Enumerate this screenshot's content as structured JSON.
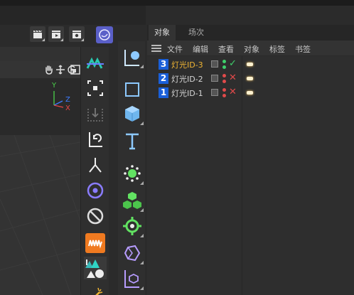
{
  "object_manager": {
    "tabs": [
      {
        "label": "对象",
        "active": true
      },
      {
        "label": "场次",
        "active": false
      }
    ],
    "menu": [
      "文件",
      "编辑",
      "查看",
      "对象",
      "标签",
      "书签"
    ],
    "objects": [
      {
        "index": "3",
        "name": "灯光ID-3",
        "selected": true,
        "status": "check",
        "status_icon": "✓"
      },
      {
        "index": "2",
        "name": "灯光ID-2",
        "selected": false,
        "status": "cross",
        "status_icon": "✕"
      },
      {
        "index": "1",
        "name": "灯光ID-1",
        "selected": false,
        "status": "cross",
        "status_icon": "✕"
      }
    ]
  },
  "viewport": {
    "axes": {
      "y": "Y",
      "z": "Z",
      "x": "X"
    }
  },
  "toolbar_left": [
    {
      "name": "motion-tracker-icon"
    },
    {
      "name": "live-selection-icon"
    },
    {
      "name": "snap-axis-icon"
    },
    {
      "name": "rotate-object-icon"
    },
    {
      "name": "split-icon"
    },
    {
      "name": "target-icon"
    },
    {
      "name": "disable-icon"
    },
    {
      "name": "sound-effector-icon"
    },
    {
      "name": "terrain-icon"
    },
    {
      "name": "wand-icon"
    }
  ],
  "toolbar_right": [
    {
      "name": "null-object-icon"
    },
    {
      "name": "plane-icon"
    },
    {
      "name": "cube-icon"
    },
    {
      "name": "text-spline-icon"
    },
    {
      "name": "cloner-icon"
    },
    {
      "name": "mograph-cubes-icon"
    },
    {
      "name": "effector-gear-icon"
    },
    {
      "name": "deformer-icon"
    },
    {
      "name": "scene-object-icon"
    }
  ],
  "colors": {
    "accent_blue": "#1a5fd8",
    "selected_name": "#f0b533",
    "check_green": "#3ed06b",
    "cross_red": "#e04a4a"
  }
}
